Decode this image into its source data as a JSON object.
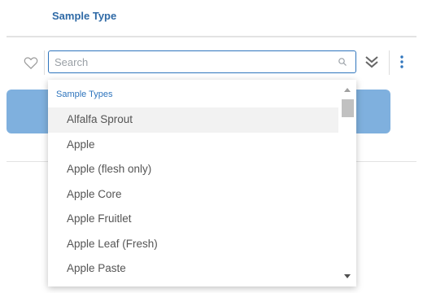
{
  "header": {
    "title": "Sample Type"
  },
  "toolbar": {
    "favorite_icon": "heart-outline-icon",
    "expand_icon": "double-chevron-down-icon",
    "more_icon": "vertical-ellipsis-icon"
  },
  "search": {
    "placeholder": "Search",
    "value": "",
    "icon": "search-icon"
  },
  "dropdown": {
    "group_label": "Sample Types",
    "options": [
      "Alfalfa Sprout",
      "Apple",
      "Apple (flesh only)",
      "Apple Core",
      "Apple Fruitlet",
      "Apple Leaf (Fresh)",
      "Apple Paste"
    ],
    "highlighted": "Alfalfa Sprout"
  },
  "colors": {
    "accent": "#2f75bd",
    "title": "#2f6aa6",
    "panel": "#7fb0de"
  }
}
